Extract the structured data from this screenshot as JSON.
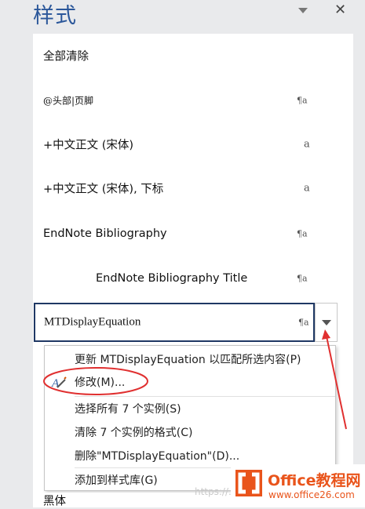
{
  "pane": {
    "title": "样式"
  },
  "styles": [
    {
      "name": "全部清除",
      "mark": ""
    },
    {
      "name": "@头部|页脚",
      "mark": "¶a"
    },
    {
      "name": "+中文正文 (宋体)",
      "mark": "a"
    },
    {
      "name": "+中文正文 (宋体), 下标",
      "mark": "a"
    },
    {
      "name": "EndNote Bibliography",
      "mark": "¶a"
    },
    {
      "name": "EndNote Bibliography Title",
      "mark": "¶a"
    }
  ],
  "selected_style": {
    "name": "MTDisplayEquation",
    "mark": "¶a"
  },
  "context_menu": {
    "items": [
      {
        "label": "更新 MTDisplayEquation 以匹配所选内容(P)"
      },
      {
        "label": "修改(M)..."
      },
      {
        "label": "选择所有 7 个实例(S)"
      },
      {
        "label": "清除 7 个实例的格式(C)"
      },
      {
        "label": "删除\"MTDisplayEquation\"(D)..."
      },
      {
        "label": "添加到样式库(G)"
      }
    ]
  },
  "bottom_style": {
    "name": "黑体"
  },
  "watermark": {
    "text": "https://..."
  },
  "logo": {
    "title": "Office教程网",
    "url": "www.office26.com"
  },
  "colors": {
    "title_blue": "#2b579a",
    "selected_border": "#1f3864",
    "annotation_red": "#e03030",
    "logo_orange": "#e9541b"
  },
  "icons": {
    "menu": "chevron-down-icon",
    "close": "close-icon",
    "dropdown": "triangle-down-icon",
    "modify": "modify-style-icon"
  }
}
